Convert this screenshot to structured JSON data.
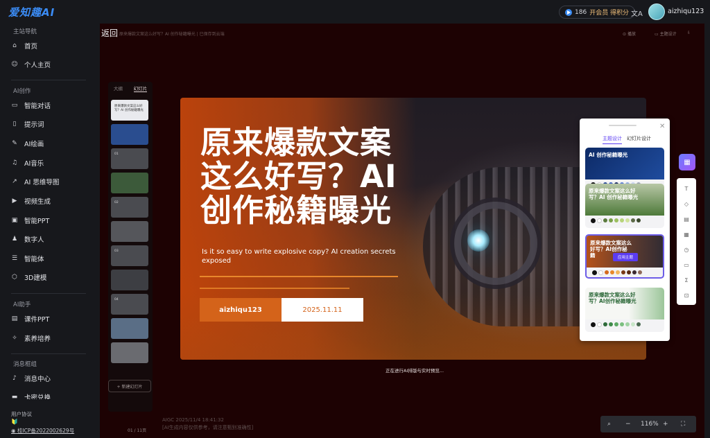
{
  "header": {
    "logo": "爱知趣AI",
    "points": "186",
    "vip_label": "开会员 得积分",
    "translate_icon": "translate-icon",
    "username": "aizhiqu123"
  },
  "sidebar": {
    "section_main": "主站导航",
    "main_items": [
      {
        "label": "首页",
        "icon": "⌂"
      },
      {
        "label": "个人主页",
        "icon": "☺"
      }
    ],
    "section_ai": "AI创作",
    "ai_items": [
      {
        "label": "智能对话",
        "icon": "▭"
      },
      {
        "label": "提示词",
        "icon": "▯"
      },
      {
        "label": "AI绘画",
        "icon": "✎"
      },
      {
        "label": "AI音乐",
        "icon": "♫"
      },
      {
        "label": "AI 思维导图",
        "icon": "↗"
      },
      {
        "label": "视频生成",
        "icon": "▶"
      },
      {
        "label": "智能PPT",
        "icon": "▣"
      },
      {
        "label": "数字人",
        "icon": "♟"
      },
      {
        "label": "智能体",
        "icon": "☰"
      },
      {
        "label": "3D建模",
        "icon": "⬡"
      }
    ],
    "section_assist": "AI助手",
    "assist_items": [
      {
        "label": "课件PPT",
        "icon": "▤"
      },
      {
        "label": "素养培养",
        "icon": "✧"
      }
    ],
    "section_msg": "消息框组",
    "msg_items": [
      {
        "label": "消息中心",
        "icon": "♪"
      },
      {
        "label": "卡密兑换",
        "icon": "▬"
      }
    ],
    "footer_agreement": "用户协议",
    "footer_icp": "桂ICP备2022002629号"
  },
  "editor": {
    "back_label": "返回",
    "doc_title": "原来爆款文案这么好写？AI 创作秘籍曝光",
    "saved_text": "已保存到云端",
    "toolbar_play": "播放",
    "toolbar_theme": "主题设计",
    "outline_tab": "大纲",
    "slides_tab": "幻灯片",
    "thumb_titles": [
      "原来爆款文案这么好写？AI 创作秘籍曝光",
      "",
      "01",
      "",
      "02",
      "",
      "03",
      "",
      "04",
      "",
      ""
    ],
    "slide_count": "01 / 11页",
    "add_slide": "+ 新建幻灯片",
    "status": "正在进行AI排版与实时预览...",
    "aigc_line1": "AIGC 2025/11/4 18:41:32",
    "aigc_line2": "[AI生成内容仅供参考，请注意甄别准确性]"
  },
  "slide": {
    "title": "原来爆款文案这么好写？AI创作秘籍曝光",
    "subtitle": "Is it so easy to write explosive copy? AI creation secrets exposed",
    "author": "aizhiqu123",
    "date": "2025.11.11"
  },
  "theme_panel": {
    "tab_theme": "主题设计",
    "tab_slide": "幻灯片设计",
    "cards": [
      {
        "title": "AI 创作秘籍曝光",
        "bg": "#173a7a",
        "title_color": "#ffffff",
        "swatches": [
          "#2a4a9a",
          "#3e64c4",
          "#1e2e66",
          "#5b7fd6",
          "#8fa8e0",
          "#c6d3f0",
          "#a0a7b5"
        ]
      },
      {
        "title": "原来爆款文案这么好写？AI 创作秘籍曝光",
        "bg": "#7a9a62",
        "title_color": "#ffffff",
        "swatches": [
          "#5b7a3e",
          "#7aa04a",
          "#9cc060",
          "#b7d47a",
          "#d0e29a",
          "#5d6b48",
          "#3c4a2e"
        ]
      },
      {
        "title": "原来爆款文案这么好写？AI创作秘籍",
        "bg": "#a85020",
        "title_color": "#ffffff",
        "swatches": [
          "#d46a1e",
          "#e8882b",
          "#f2b45b",
          "#7a3a15",
          "#5a2a10",
          "#3c2a30",
          "#8f6a5a"
        ]
      },
      {
        "title": "原来爆款文案这么好写？AI创作秘籍曝光",
        "bg": "#f4f6f3",
        "title_color": "#2e6a3a",
        "swatches": [
          "#2e6a3a",
          "#3f8a4a",
          "#5ca864",
          "#7bbf80",
          "#a0d3a3",
          "#c8e6c9",
          "#4a6a52"
        ]
      }
    ],
    "apply_label": "应用主题"
  },
  "tools": [
    "T",
    "◇",
    "▤",
    "▦",
    "◷",
    "▭",
    "Σ",
    "⊡"
  ],
  "zoom": {
    "level": "116%",
    "minus": "−",
    "plus": "+"
  }
}
